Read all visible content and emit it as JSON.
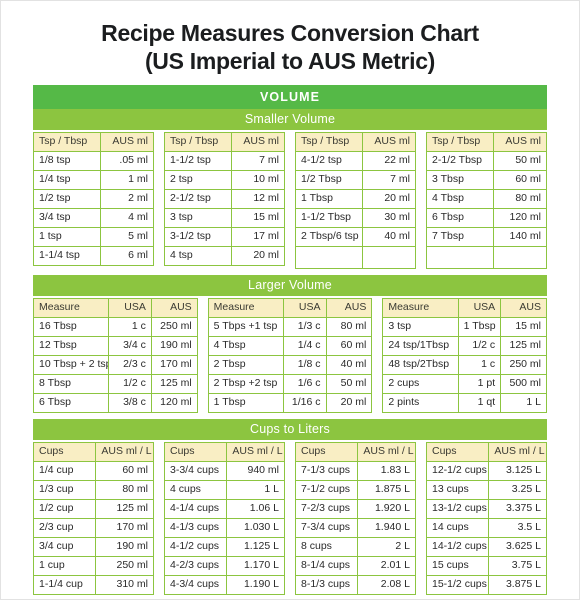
{
  "title": {
    "line1": "Recipe Measures Conversion Chart",
    "line2": "(US Imperial to AUS Metric)"
  },
  "colors": {
    "band_main": "#55b947",
    "band_sub": "#8cc540",
    "header_cell": "#f9eec4",
    "border": "#8cc540",
    "text": "#2a2a2a"
  },
  "sections": {
    "volume": {
      "band_label": "VOLUME",
      "smaller": {
        "band_label": "Smaller Volume",
        "headers": [
          "Tsp / Tbsp",
          "AUS ml"
        ],
        "columns": [
          {
            "rows": [
              [
                "1/8 tsp",
                ".05 ml"
              ],
              [
                "1/4 tsp",
                "1 ml"
              ],
              [
                "1/2 tsp",
                "2 ml"
              ],
              [
                "3/4 tsp",
                "4 ml"
              ],
              [
                "1 tsp",
                "5 ml"
              ],
              [
                "1-1/4 tsp",
                "6 ml"
              ]
            ],
            "blank_rows": 0
          },
          {
            "rows": [
              [
                "1-1/2 tsp",
                "7 ml"
              ],
              [
                "2 tsp",
                "10 ml"
              ],
              [
                "2-1/2 tsp",
                "12 ml"
              ],
              [
                "3 tsp",
                "15 ml"
              ],
              [
                "3-1/2 tsp",
                "17 ml"
              ],
              [
                "4 tsp",
                "20 ml"
              ]
            ],
            "blank_rows": 0
          },
          {
            "rows": [
              [
                "4-1/2 tsp",
                "22 ml"
              ],
              [
                "1/2 Tbsp",
                "7 ml"
              ],
              [
                "1 Tbsp",
                "20 ml"
              ],
              [
                "1-1/2 Tbsp",
                "30 ml"
              ],
              [
                "2 Tbsp/6 tsp",
                "40 ml"
              ]
            ],
            "blank_rows": 1
          },
          {
            "rows": [
              [
                "2-1/2 Tbsp",
                "50 ml"
              ],
              [
                "3 Tbsp",
                "60 ml"
              ],
              [
                "4 Tbsp",
                "80 ml"
              ],
              [
                "6 Tbsp",
                "120 ml"
              ],
              [
                "7 Tbsp",
                "140 ml"
              ]
            ],
            "blank_rows": 1
          }
        ]
      },
      "larger": {
        "band_label": "Larger Volume",
        "headers": [
          "Measure",
          "USA",
          "AUS"
        ],
        "columns": [
          {
            "rows": [
              [
                "16 Tbsp",
                "1 c",
                "250 ml"
              ],
              [
                "12 Tbsp",
                "3/4 c",
                "190 ml"
              ],
              [
                "10 Tbsp + 2 tsp",
                "2/3 c",
                "170 ml"
              ],
              [
                "8 Tbsp",
                "1/2 c",
                "125 ml"
              ],
              [
                "6 Tbsp",
                "3/8 c",
                "120 ml"
              ]
            ]
          },
          {
            "rows": [
              [
                "5 Tbps +1 tsp",
                "1/3 c",
                "80 ml"
              ],
              [
                "4 Tbsp",
                "1/4 c",
                "60 ml"
              ],
              [
                "2 Tbsp",
                "1/8 c",
                "40 ml"
              ],
              [
                "2 Tbsp +2 tsp",
                "1/6 c",
                "50 ml"
              ],
              [
                "1 Tbsp",
                "1/16 c",
                "20 ml"
              ]
            ]
          },
          {
            "rows": [
              [
                "3 tsp",
                "1 Tbsp",
                "15 ml"
              ],
              [
                "24 tsp/1Tbsp",
                "1/2 c",
                "125 ml"
              ],
              [
                "48 tsp/2Tbsp",
                "1 c",
                "250 ml"
              ],
              [
                "2 cups",
                "1 pt",
                "500 ml"
              ],
              [
                "2 pints",
                "1 qt",
                "1 L"
              ]
            ]
          }
        ]
      },
      "cups_to_liters": {
        "band_label": "Cups to Liters",
        "headers": [
          "Cups",
          "AUS  ml / L"
        ],
        "columns": [
          {
            "rows": [
              [
                "1/4 cup",
                "60 ml"
              ],
              [
                "1/3 cup",
                "80 ml"
              ],
              [
                "1/2 cup",
                "125 ml"
              ],
              [
                "2/3 cup",
                "170 ml"
              ],
              [
                "3/4 cup",
                "190 ml"
              ],
              [
                "1 cup",
                "250 ml"
              ],
              [
                "1-1/4 cup",
                "310 ml"
              ]
            ]
          },
          {
            "rows": [
              [
                "3-3/4 cups",
                "940 ml"
              ],
              [
                "4 cups",
                "1 L"
              ],
              [
                "4-1/4 cups",
                "1.06 L"
              ],
              [
                "4-1/3 cups",
                "1.030 L"
              ],
              [
                "4-1/2 cups",
                "1.125 L"
              ],
              [
                "4-2/3 cups",
                "1.170 L"
              ],
              [
                "4-3/4 cups",
                "1.190 L"
              ]
            ]
          },
          {
            "rows": [
              [
                "7-1/3 cups",
                "1.83 L"
              ],
              [
                "7-1/2 cups",
                "1.875 L"
              ],
              [
                "7-2/3 cups",
                "1.920 L"
              ],
              [
                "7-3/4 cups",
                "1.940 L"
              ],
              [
                "8 cups",
                "2 L"
              ],
              [
                "8-1/4 cups",
                "2.01 L"
              ],
              [
                "8-1/3 cups",
                "2.08 L"
              ]
            ]
          },
          {
            "rows": [
              [
                "12-1/2 cups",
                "3.125 L"
              ],
              [
                "13 cups",
                "3.25 L"
              ],
              [
                "13-1/2 cups",
                "3.375 L"
              ],
              [
                "14 cups",
                "3.5 L"
              ],
              [
                "14-1/2 cups",
                "3.625 L"
              ],
              [
                "15 cups",
                "3.75 L"
              ],
              [
                "15-1/2 cups",
                "3.875 L"
              ]
            ]
          }
        ]
      }
    }
  }
}
